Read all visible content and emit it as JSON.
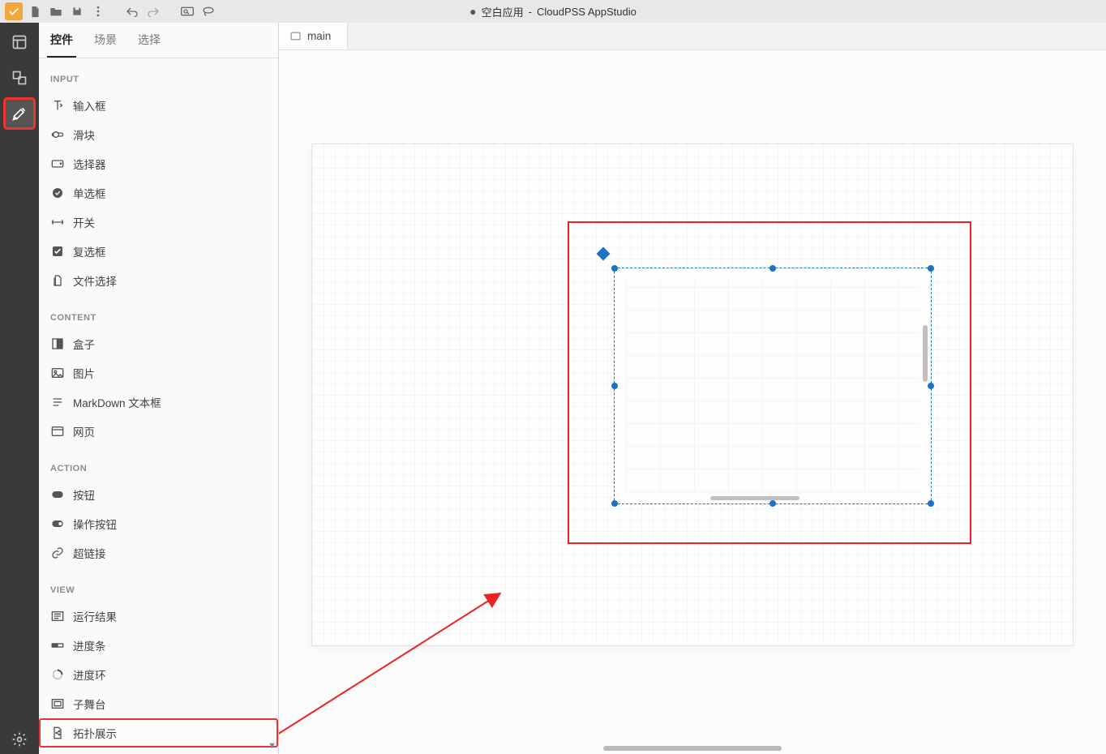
{
  "app": {
    "title_prefix": "空白应用",
    "title_suffix": "CloudPSS AppStudio",
    "modified": true
  },
  "toolbar": {
    "icons": [
      "logo",
      "new-file",
      "open-folder",
      "save",
      "more",
      "undo",
      "redo",
      "search-box",
      "lasso"
    ]
  },
  "left_rail": {
    "items": [
      {
        "name": "rail-dashboard",
        "active": false
      },
      {
        "name": "rail-layers",
        "active": false
      },
      {
        "name": "rail-tools",
        "active": true
      }
    ],
    "footer": "rail-settings"
  },
  "sidebar": {
    "tabs": [
      {
        "label": "控件",
        "active": true
      },
      {
        "label": "场景",
        "active": false
      },
      {
        "label": "选择",
        "active": false
      }
    ],
    "sections": [
      {
        "title": "INPUT",
        "items": [
          {
            "name": "widget-input-text",
            "icon": "text-icon",
            "label": "输入框"
          },
          {
            "name": "widget-slider",
            "icon": "slider-icon",
            "label": "滑块"
          },
          {
            "name": "widget-select",
            "icon": "select-icon",
            "label": "选择器"
          },
          {
            "name": "widget-radio",
            "icon": "radio-icon",
            "label": "单选框"
          },
          {
            "name": "widget-switch",
            "icon": "switch-icon",
            "label": "开关"
          },
          {
            "name": "widget-checkbox",
            "icon": "checkbox-icon",
            "label": "复选框"
          },
          {
            "name": "widget-file",
            "icon": "file-icon",
            "label": "文件选择"
          }
        ]
      },
      {
        "title": "CONTENT",
        "items": [
          {
            "name": "widget-box",
            "icon": "box-icon",
            "label": "盒子"
          },
          {
            "name": "widget-image",
            "icon": "image-icon",
            "label": "图片"
          },
          {
            "name": "widget-markdown",
            "icon": "markdown-icon",
            "label": "MarkDown 文本框"
          },
          {
            "name": "widget-web",
            "icon": "web-icon",
            "label": "网页"
          }
        ]
      },
      {
        "title": "ACTION",
        "items": [
          {
            "name": "widget-button",
            "icon": "button-icon",
            "label": "按钮"
          },
          {
            "name": "widget-opbutton",
            "icon": "opbutton-icon",
            "label": "操作按钮"
          },
          {
            "name": "widget-link",
            "icon": "link-icon",
            "label": "超链接"
          }
        ]
      },
      {
        "title": "VIEW",
        "items": [
          {
            "name": "widget-result",
            "icon": "result-icon",
            "label": "运行结果"
          },
          {
            "name": "widget-progressbar",
            "icon": "progressbar-icon",
            "label": "进度条"
          },
          {
            "name": "widget-progressring",
            "icon": "progressring-icon",
            "label": "进度环"
          },
          {
            "name": "widget-substage",
            "icon": "substage-icon",
            "label": "子舞台"
          },
          {
            "name": "widget-topology",
            "icon": "topology-icon",
            "label": "拓扑展示",
            "highlight": true
          }
        ]
      }
    ]
  },
  "main": {
    "tabs": [
      {
        "label": "main"
      }
    ]
  }
}
